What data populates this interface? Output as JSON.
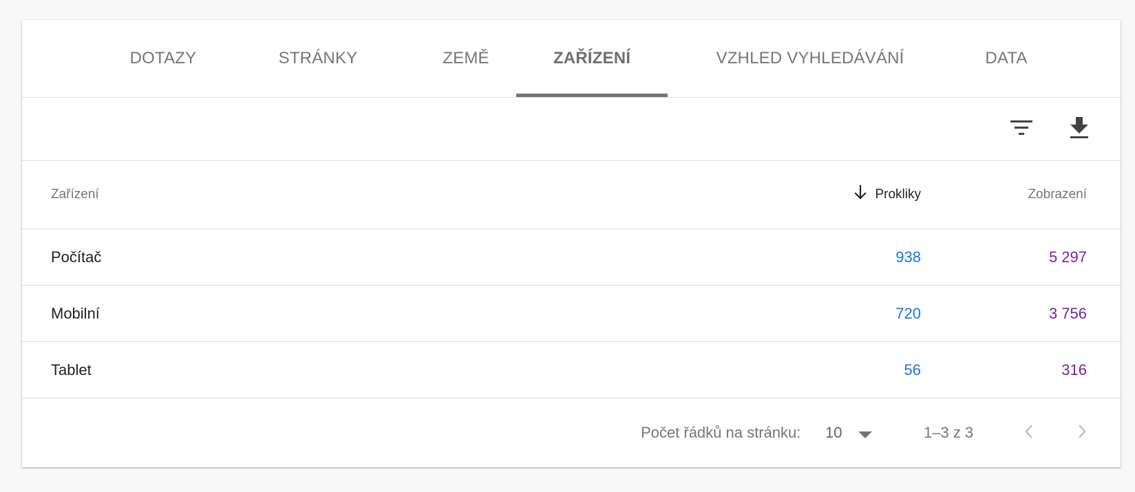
{
  "tabs": [
    {
      "label": "DOTAZY"
    },
    {
      "label": "STRÁNKY"
    },
    {
      "label": "ZEMĚ"
    },
    {
      "label": "ZAŘÍZENÍ"
    },
    {
      "label": "VZHLED VYHLEDÁVÁNÍ"
    },
    {
      "label": "DATA"
    }
  ],
  "toolbar": {
    "filter_icon": "filter-icon",
    "download_icon": "download-icon"
  },
  "table": {
    "headers": {
      "device": "Zařízení",
      "clicks": "Prokliky",
      "impressions": "Zobrazení"
    },
    "rows": [
      {
        "device": "Počítač",
        "clicks": "938",
        "impressions": "5 297"
      },
      {
        "device": "Mobilní",
        "clicks": "720",
        "impressions": "3 756"
      },
      {
        "device": "Tablet",
        "clicks": "56",
        "impressions": "316"
      }
    ]
  },
  "footer": {
    "rows_per_page_label": "Počet řádků na stránku:",
    "rows_per_page_value": "10",
    "range_text": "1–3 z 3"
  },
  "colors": {
    "clicks": "#1a73e8",
    "impressions": "#7b1fa2"
  }
}
